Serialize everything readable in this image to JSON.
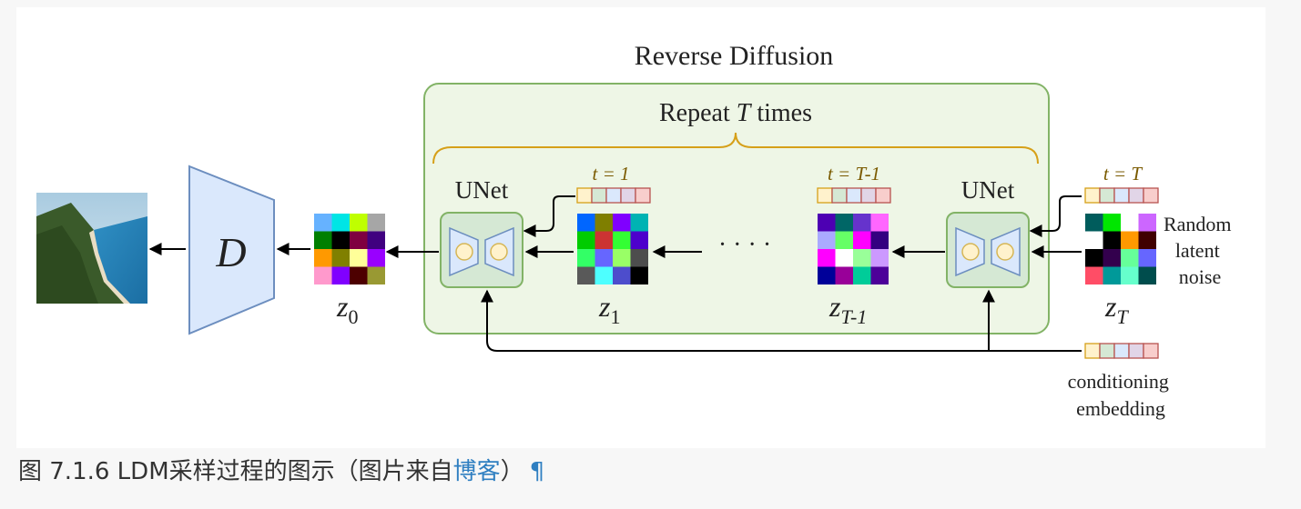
{
  "diagram": {
    "title": "Reverse Diffusion",
    "repeat_label": {
      "prefix": "Repeat ",
      "var": "T",
      "suffix": " times"
    },
    "decoder_label": "D",
    "unet_left_label": "UNet",
    "unet_right_label": "UNet",
    "time_labels": {
      "t1": "t = 1",
      "tT1": "t = T-1",
      "tT": "t = T"
    },
    "latents": {
      "z0": {
        "base": "z",
        "sub": "0"
      },
      "z1": {
        "base": "z",
        "sub": "1"
      },
      "zT1": {
        "base": "z",
        "sub": "T-1"
      },
      "zT": {
        "base": "z",
        "sub": "T"
      }
    },
    "ellipsis": "· · · ·",
    "noise_label": [
      "Random",
      "latent",
      "noise"
    ],
    "conditioning_label": [
      "conditioning",
      "embedding"
    ],
    "colors": {
      "panel_fill": "#eef6e6",
      "panel_stroke": "#82b366",
      "unet_fill": "#d5e8d4",
      "brace": "#d6a019",
      "decoder_fill": "#dae8fc",
      "decoder_stroke": "#6c8ebf",
      "circle_fill": "#fff2cc",
      "circle_stroke": "#d6b656",
      "time_text": "#7a5a00"
    },
    "embedding_colors": [
      "#fff2cc",
      "#d5e8d4",
      "#dae8fc",
      "#e1d5e7",
      "#f8cecc"
    ],
    "grids": {
      "z0": [
        "#66b2ff",
        "#00e5e5",
        "#bfff00",
        "#a6a6a6",
        "#007f00",
        "#000000",
        "#7f0040",
        "#400080",
        "#ff9900",
        "#808000",
        "#ffff99",
        "#9900ff",
        "#ff99cc",
        "#8000ff",
        "#4d0000",
        "#999933"
      ],
      "z1": [
        "#0066ff",
        "#7f7f00",
        "#8000ff",
        "#00b3b3",
        "#00cc00",
        "#cc3333",
        "#33ff33",
        "#4d00cc",
        "#33ff66",
        "#6666ff",
        "#99ff66",
        "#4d4d4d",
        "#595959",
        "#4dffff",
        "#4d4dcc",
        "#000000"
      ],
      "zT1": [
        "#4d00b3",
        "#006666",
        "#6633cc",
        "#ff66ff",
        "#aaaaff",
        "#66ff66",
        "#ff00ff",
        "#330080",
        "#ff00ff",
        "#ffffff",
        "#99ff99",
        "#cc99ff",
        "#000099",
        "#990099",
        "#00cc99",
        "#4d0099"
      ],
      "zT": [
        "#005c5c",
        "#00e600",
        "#ffffff",
        "#cc66ff",
        "#ffffff",
        "#000000",
        "#ff9900",
        "#400000",
        "#000000",
        "#33004d",
        "#66ff99",
        "#6666ff",
        "#ff4d66",
        "#009999",
        "#66ffcc",
        "#004d4d"
      ]
    }
  },
  "caption": {
    "prefix": "图 7.1.6 LDM采样过程的图示（图片来自",
    "link": "博客",
    "suffix": "）",
    "anchor": "¶"
  }
}
